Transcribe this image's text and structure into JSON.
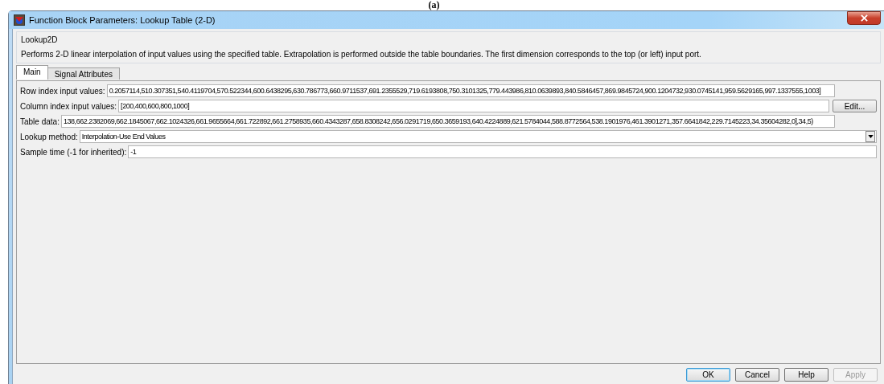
{
  "caption": "(a)",
  "window": {
    "title": "Function Block Parameters: Lookup Table (2-D)"
  },
  "block": {
    "name": "Lookup2D",
    "description": "Performs 2-D linear interpolation of input values using the specified table.  Extrapolation is performed outside the table boundaries.  The first dimension corresponds to the top (or left) input port."
  },
  "tabs": [
    {
      "label": "Main",
      "selected": true
    },
    {
      "label": "Signal Attributes",
      "selected": false
    }
  ],
  "parameters": [
    {
      "kind": "text",
      "label": "Row index input values:",
      "value": "0.2057114,510.307351,540.4119704,570.522344,600.6438295,630.786773,660.9711537,691.2355529,719.6193808,750.3101325,779.443986,810.0639893,840.5846457,869.9845724,900.1204732,930.0745141,959.5629165,997.1337555,1003]"
    },
    {
      "kind": "text_button",
      "label": "Column index input values:",
      "value": "[200,400,600,800,1000]",
      "button": "Edit..."
    },
    {
      "kind": "text",
      "label": "Table data:",
      "value": "138,662.2382069,662.1845067,662.1024326,661.9655664,661.722892,661.2758935,660.4343287,658.8308242,656.0291719,650.3659193,640.4224889,621.5784044,588.8772564,538.1901976,461.3901271,357.6641842,229.7145223,34.35604282,0],34,5)"
    },
    {
      "kind": "dropdown",
      "label": "Lookup method:",
      "value": "Interpolation-Use End Values"
    },
    {
      "kind": "wide_text",
      "label": "Sample time (-1 for inherited):",
      "value": "-1"
    }
  ],
  "buttons": [
    {
      "label": "OK",
      "focused": true,
      "disabled": false
    },
    {
      "label": "Cancel",
      "focused": false,
      "disabled": false
    },
    {
      "label": "Help",
      "focused": false,
      "disabled": false
    },
    {
      "label": "Apply",
      "focused": false,
      "disabled": true
    }
  ]
}
